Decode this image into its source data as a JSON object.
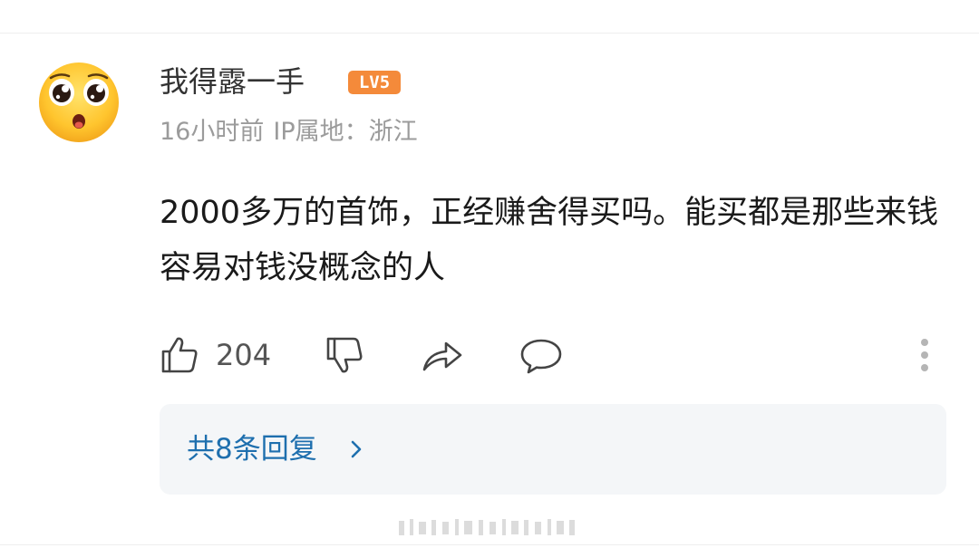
{
  "comment_card": {
    "username": "我得露一手",
    "level_badge": "LV5",
    "time": "16小时前",
    "ip_location": "IP属地：浙江",
    "text": "2000多万的首饰，正经赚舍得买吗。能买都是那些来钱容易对钱没概念的人",
    "likes": "204",
    "replies_label": "共8条回复"
  },
  "icons": {
    "avatar": "crying-emoji-avatar",
    "like": "thumbs-up-icon",
    "dislike": "thumbs-down-icon",
    "share": "share-arrow-icon",
    "comment": "comment-bubble-icon",
    "more": "more-vertical-icon",
    "chevron": "chevron-right-icon"
  },
  "colors": {
    "level_badge": "#f48a3a",
    "reply_link": "#1e6fae",
    "meta_text": "#9b9b9b",
    "reply_panel": "#f4f6f8"
  }
}
